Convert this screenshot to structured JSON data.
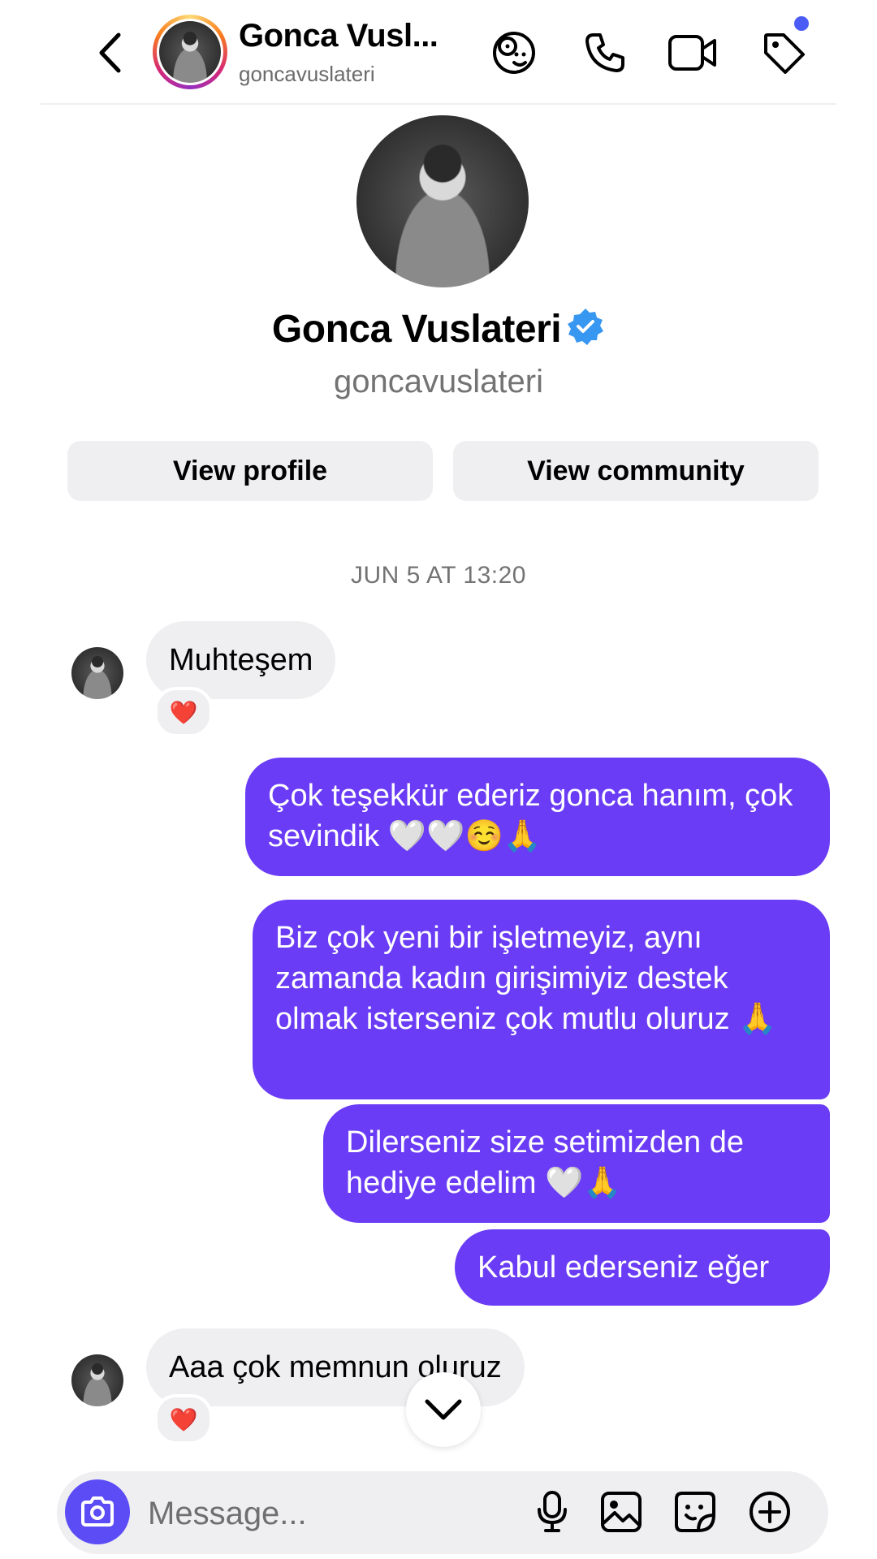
{
  "header": {
    "name": "Gonca Vusl...",
    "username": "goncavuslateri",
    "icons": [
      "back-icon",
      "sticker-face-icon",
      "phone-icon",
      "video-camera-icon",
      "tag-icon"
    ],
    "notification_dot_color": "#4a5cf5"
  },
  "profile": {
    "name": "Gonca Vuslateri",
    "username": "goncavuslateri",
    "verified": true,
    "view_profile_label": "View profile",
    "view_community_label": "View community"
  },
  "timestamp": "JUN 5 AT 13:20",
  "messages": [
    {
      "direction": "incoming",
      "text": "Muhteşem",
      "reaction": "❤️"
    },
    {
      "direction": "outgoing",
      "text": "Çok teşekkür ederiz gonca hanım, çok sevindik 🤍🤍☺️🙏"
    },
    {
      "direction": "outgoing",
      "text": "Biz çok yeni bir işletmeyiz, aynı zamanda kadın girişimiyiz destek olmak isterseniz çok mutlu oluruz 🙏"
    },
    {
      "direction": "outgoing",
      "text": "Dilerseniz size setimizden de hediye edelim 🤍🙏"
    },
    {
      "direction": "outgoing",
      "text": "Kabul ederseniz eğer"
    },
    {
      "direction": "incoming",
      "text": "Aaa çok memnun oluruz",
      "reaction": "❤️"
    }
  ],
  "composer": {
    "placeholder": "Message...",
    "icons": [
      "camera-icon",
      "microphone-icon",
      "gallery-icon",
      "sticker-icon",
      "add-icon"
    ]
  },
  "colors": {
    "outgoing_bubble": "#6a3cf5",
    "incoming_bubble": "#efeff2",
    "camera_button": "#5b4cf6",
    "verified_badge": "#3897f0"
  }
}
